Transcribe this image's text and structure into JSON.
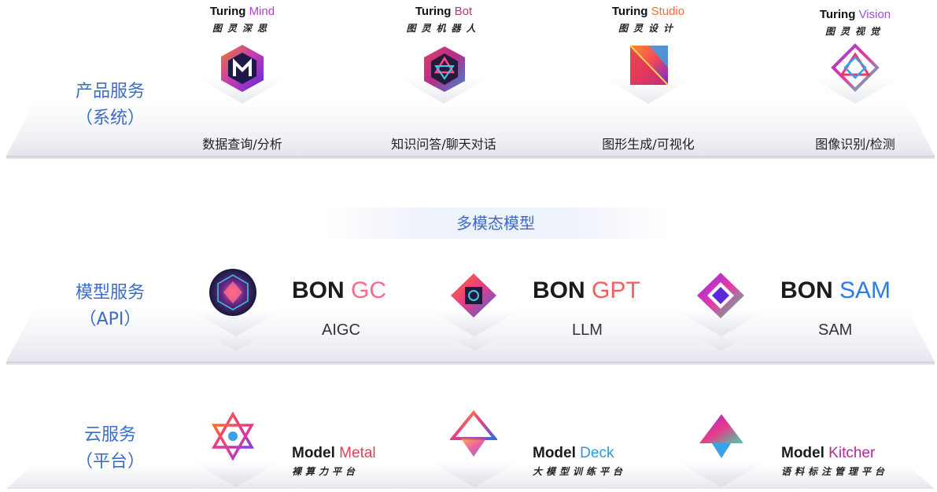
{
  "layers": {
    "product": {
      "label_line1": "产品服务",
      "label_line2": "（系统）"
    },
    "model": {
      "label_line1": "模型服务",
      "label_line2": "（API）"
    },
    "cloud": {
      "label_line1": "云服务",
      "label_line2": "（平台）"
    }
  },
  "products": [
    {
      "brand": "Turing",
      "name": "Mind",
      "sub": "图灵深思",
      "desc": "数据查询/分析",
      "color": "#b03fd1"
    },
    {
      "brand": "Turing",
      "name": "Bot",
      "sub": "图灵机器人",
      "desc": "知识问答/聊天对话",
      "color": "#c0307a"
    },
    {
      "brand": "Turing",
      "name": "Studio",
      "sub": "图灵设计",
      "desc": "图形生成/可视化",
      "color": "#f06a3a"
    },
    {
      "brand": "Turing",
      "name": "Vision",
      "sub": "图灵视觉",
      "desc": "图像识别/检测",
      "color": "#9a4fe0"
    }
  ],
  "multimodal_banner": "多模态模型",
  "models": [
    {
      "brand": "BON",
      "name": "GC",
      "abbr": "AIGC",
      "color_from": "#ff6a8a",
      "color_to": "#3fc9e8"
    },
    {
      "brand": "BON",
      "name": "GPT",
      "abbr": "LLM",
      "color_from": "#ff4b8a",
      "color_to": "#ff9a3c"
    },
    {
      "brand": "BON",
      "name": "SAM",
      "abbr": "SAM",
      "color_from": "#2a7de8",
      "color_to": "#3aa0f0"
    }
  ],
  "clouds": [
    {
      "brand": "Model",
      "name": "Metal",
      "sub": "裸算力平台",
      "color": "#e0405a"
    },
    {
      "brand": "Model",
      "name": "Deck",
      "sub": "大模型训练平台",
      "color": "#2a9ad8"
    },
    {
      "brand": "Model",
      "name": "Kitcher",
      "sub": "语料标注管理平台",
      "color": "#b02a9a"
    }
  ]
}
